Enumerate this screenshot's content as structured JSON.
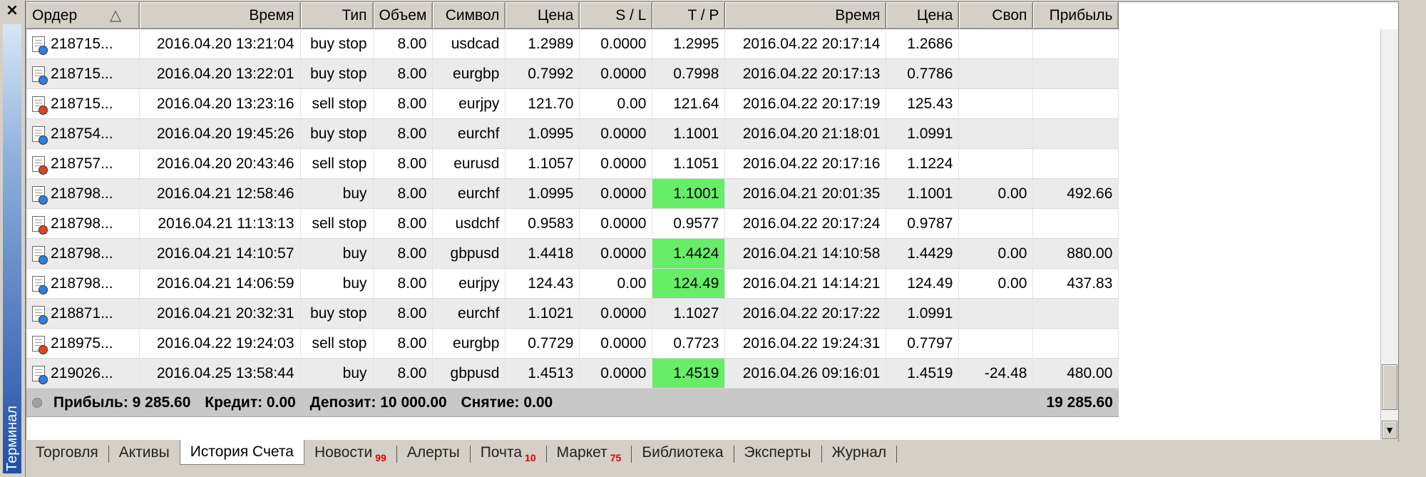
{
  "window": {
    "title": "Терминал",
    "close_icon": "×"
  },
  "table": {
    "columns": [
      "Ордер",
      "Время",
      "Тип",
      "Объем",
      "Символ",
      "Цена",
      "S / L",
      "T / P",
      "Время",
      "Цена",
      "Своп",
      "Прибыль"
    ],
    "sort_indicator": "△",
    "rows": [
      {
        "order": "218715...",
        "time": "2016.04.20 13:21:04",
        "type": "buy stop",
        "volume": "8.00",
        "symbol": "usdcad",
        "price": "1.2989",
        "sl": "0.0000",
        "tp": "1.2995",
        "close_time": "2016.04.22 20:17:14",
        "close_price": "1.2686",
        "swap": "",
        "profit": "",
        "icon": "blue",
        "tp_hit": false
      },
      {
        "order": "218715...",
        "time": "2016.04.20 13:22:01",
        "type": "buy stop",
        "volume": "8.00",
        "symbol": "eurgbp",
        "price": "0.7992",
        "sl": "0.0000",
        "tp": "0.7998",
        "close_time": "2016.04.22 20:17:13",
        "close_price": "0.7786",
        "swap": "",
        "profit": "",
        "icon": "blue",
        "tp_hit": false
      },
      {
        "order": "218715...",
        "time": "2016.04.20 13:23:16",
        "type": "sell stop",
        "volume": "8.00",
        "symbol": "eurjpy",
        "price": "121.70",
        "sl": "0.00",
        "tp": "121.64",
        "close_time": "2016.04.22 20:17:19",
        "close_price": "125.43",
        "swap": "",
        "profit": "",
        "icon": "red",
        "tp_hit": false
      },
      {
        "order": "218754...",
        "time": "2016.04.20 19:45:26",
        "type": "buy stop",
        "volume": "8.00",
        "symbol": "eurchf",
        "price": "1.0995",
        "sl": "0.0000",
        "tp": "1.1001",
        "close_time": "2016.04.20 21:18:01",
        "close_price": "1.0991",
        "swap": "",
        "profit": "",
        "icon": "blue",
        "tp_hit": false
      },
      {
        "order": "218757...",
        "time": "2016.04.20 20:43:46",
        "type": "sell stop",
        "volume": "8.00",
        "symbol": "eurusd",
        "price": "1.1057",
        "sl": "0.0000",
        "tp": "1.1051",
        "close_time": "2016.04.22 20:17:16",
        "close_price": "1.1224",
        "swap": "",
        "profit": "",
        "icon": "red",
        "tp_hit": false
      },
      {
        "order": "218798...",
        "time": "2016.04.21 12:58:46",
        "type": "buy",
        "volume": "8.00",
        "symbol": "eurchf",
        "price": "1.0995",
        "sl": "0.0000",
        "tp": "1.1001",
        "close_time": "2016.04.21 20:01:35",
        "close_price": "1.1001",
        "swap": "0.00",
        "profit": "492.66",
        "icon": "blue",
        "tp_hit": true
      },
      {
        "order": "218798...",
        "time": "2016.04.21 11:13:13",
        "type": "sell stop",
        "volume": "8.00",
        "symbol": "usdchf",
        "price": "0.9583",
        "sl": "0.0000",
        "tp": "0.9577",
        "close_time": "2016.04.22 20:17:24",
        "close_price": "0.9787",
        "swap": "",
        "profit": "",
        "icon": "red",
        "tp_hit": false
      },
      {
        "order": "218798...",
        "time": "2016.04.21 14:10:57",
        "type": "buy",
        "volume": "8.00",
        "symbol": "gbpusd",
        "price": "1.4418",
        "sl": "0.0000",
        "tp": "1.4424",
        "close_time": "2016.04.21 14:10:58",
        "close_price": "1.4429",
        "swap": "0.00",
        "profit": "880.00",
        "icon": "blue",
        "tp_hit": true
      },
      {
        "order": "218798...",
        "time": "2016.04.21 14:06:59",
        "type": "buy",
        "volume": "8.00",
        "symbol": "eurjpy",
        "price": "124.43",
        "sl": "0.00",
        "tp": "124.49",
        "close_time": "2016.04.21 14:14:21",
        "close_price": "124.49",
        "swap": "0.00",
        "profit": "437.83",
        "icon": "blue",
        "tp_hit": true
      },
      {
        "order": "218871...",
        "time": "2016.04.21 20:32:31",
        "type": "buy stop",
        "volume": "8.00",
        "symbol": "eurchf",
        "price": "1.1021",
        "sl": "0.0000",
        "tp": "1.1027",
        "close_time": "2016.04.22 20:17:22",
        "close_price": "1.0991",
        "swap": "",
        "profit": "",
        "icon": "blue",
        "tp_hit": false
      },
      {
        "order": "218975...",
        "time": "2016.04.22 19:24:03",
        "type": "sell stop",
        "volume": "8.00",
        "symbol": "eurgbp",
        "price": "0.7729",
        "sl": "0.0000",
        "tp": "0.7723",
        "close_time": "2016.04.22 19:24:31",
        "close_price": "0.7797",
        "swap": "",
        "profit": "",
        "icon": "red",
        "tp_hit": false
      },
      {
        "order": "219026...",
        "time": "2016.04.25 13:58:44",
        "type": "buy",
        "volume": "8.00",
        "symbol": "gbpusd",
        "price": "1.4513",
        "sl": "0.0000",
        "tp": "1.4519",
        "close_time": "2016.04.26 09:16:01",
        "close_price": "1.4519",
        "swap": "-24.48",
        "profit": "480.00",
        "icon": "blue",
        "tp_hit": true
      }
    ]
  },
  "summary": {
    "profit": "Прибыль: 9 285.60",
    "credit": "Кредит: 0.00",
    "deposit": "Депозит: 10 000.00",
    "withdrawal": "Снятие: 0.00",
    "total": "19 285.60"
  },
  "tabs": [
    {
      "label": "Торговля",
      "badge": ""
    },
    {
      "label": "Активы",
      "badge": ""
    },
    {
      "label": "История Счета",
      "badge": "",
      "active": true
    },
    {
      "label": "Новости",
      "badge": "99"
    },
    {
      "label": "Алерты",
      "badge": ""
    },
    {
      "label": "Почта",
      "badge": "10"
    },
    {
      "label": "Маркет",
      "badge": "75"
    },
    {
      "label": "Библиотека",
      "badge": ""
    },
    {
      "label": "Эксперты",
      "badge": ""
    },
    {
      "label": "Журнал",
      "badge": ""
    }
  ],
  "colors": {
    "tp_hit": "#66ee66",
    "buy_icon": "#2c7fe0",
    "sell_icon": "#e0431f",
    "badge": "#e00000"
  }
}
